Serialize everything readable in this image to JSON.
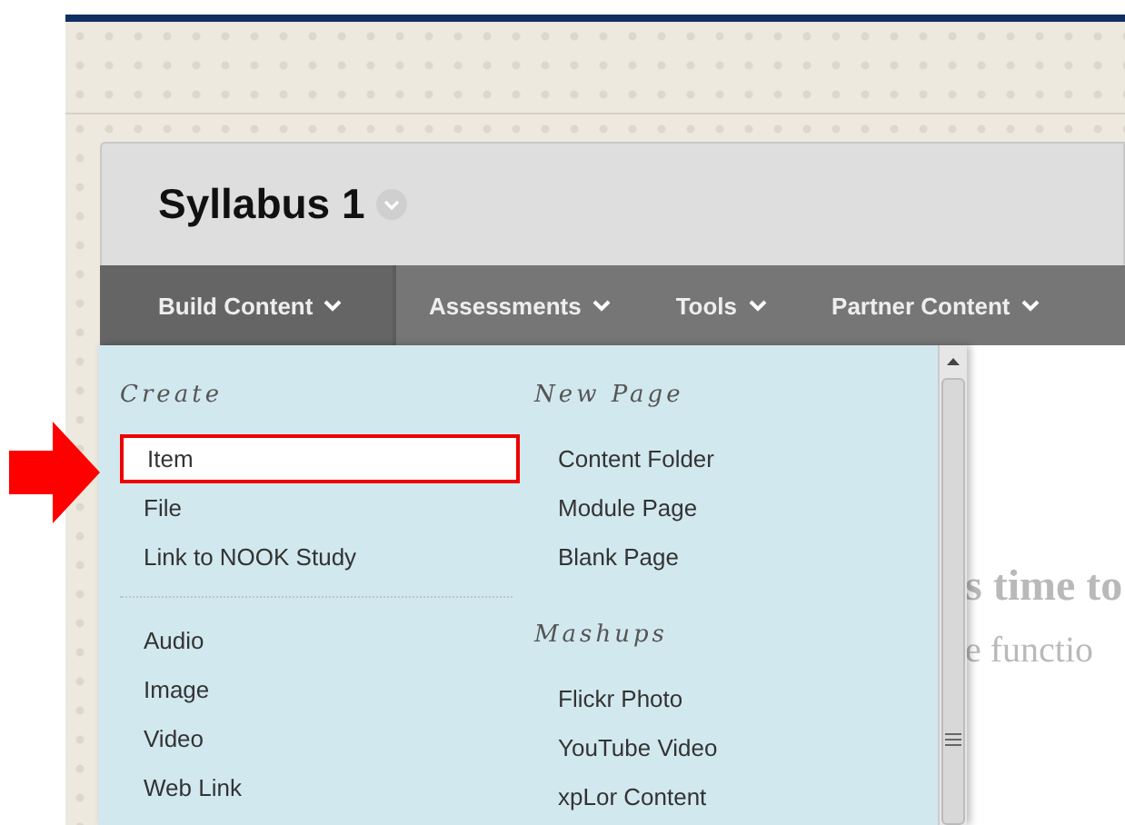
{
  "page_title": "Syllabus 1",
  "nav_tabs": [
    {
      "label": "Build Content",
      "selected": true
    },
    {
      "label": "Assessments",
      "selected": false
    },
    {
      "label": "Tools",
      "selected": false
    },
    {
      "label": "Partner Content",
      "selected": false
    }
  ],
  "menu": {
    "columns": [
      {
        "kind": "divided",
        "sections": [
          {
            "heading": "Create",
            "items": [
              {
                "label": "Item",
                "selected": true
              },
              {
                "label": "File",
                "selected": false
              },
              {
                "label": "Link to NOOK Study",
                "selected": false
              }
            ]
          },
          {
            "items": [
              {
                "label": "Audio",
                "selected": false
              },
              {
                "label": "Image",
                "selected": false
              },
              {
                "label": "Video",
                "selected": false
              },
              {
                "label": "Web Link",
                "selected": false
              }
            ]
          }
        ]
      },
      {
        "kind": "plain",
        "sections": [
          {
            "heading": "New Page",
            "items": [
              {
                "label": "Content Folder",
                "selected": false
              },
              {
                "label": "Module Page",
                "selected": false
              },
              {
                "label": "Blank Page",
                "selected": false
              }
            ]
          },
          {
            "heading": "Mashups",
            "items": [
              {
                "label": "Flickr Photo",
                "selected": false
              },
              {
                "label": "YouTube Video",
                "selected": false
              },
              {
                "label": "xpLor Content",
                "selected": false
              }
            ]
          }
        ]
      }
    ]
  },
  "background_text": [
    "s time to",
    "e functio"
  ]
}
